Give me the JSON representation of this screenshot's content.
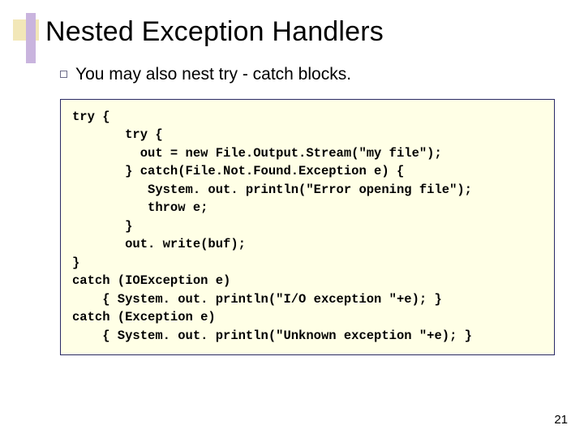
{
  "title": "Nested Exception Handlers",
  "bullet": "You may also nest try - catch blocks.",
  "code": "try {\n       try {\n         out = new File.Output.Stream(\"my file\");\n       } catch(File.Not.Found.Exception e) {\n          System. out. println(\"Error opening file\");\n          throw e;\n       }\n       out. write(buf);\n}\ncatch (IOException e)\n    { System. out. println(\"I/O exception \"+e); }\ncatch (Exception e)\n    { System. out. println(\"Unknown exception \"+e); }",
  "pageNumber": "21"
}
